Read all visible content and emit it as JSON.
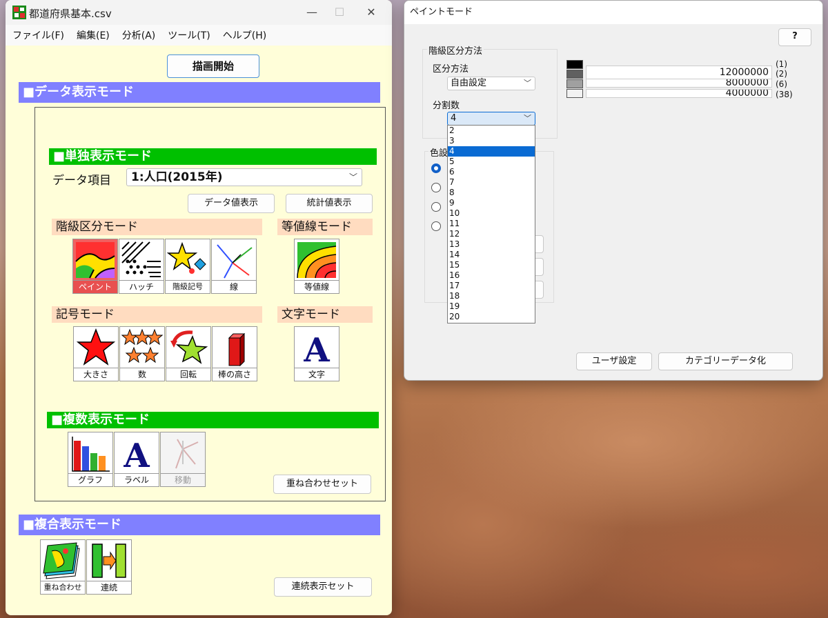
{
  "main": {
    "title": "都道府県基本.csv",
    "menu": [
      "ファイル(F)",
      "編集(E)",
      "分析(A)",
      "ツール(T)",
      "ヘルプ(H)"
    ],
    "draw_button": "描画開始",
    "data_mode_title": "■データ表示モード",
    "single_mode_title": "■単独表示モード",
    "data_item_label": "データ項目",
    "data_item_value": "1:人口(2015年)",
    "show_data_button": "データ値表示",
    "show_stats_button": "統計値表示",
    "class_mode_title": "階級区分モード",
    "contour_mode_title": "等値線モード",
    "class_tools": [
      "ペイント",
      "ハッチ",
      "階級記号",
      "線"
    ],
    "contour_tool": "等値線",
    "symbol_mode_title": "記号モード",
    "text_mode_title": "文字モード",
    "symbol_tools": [
      "大きさ",
      "数",
      "回転",
      "棒の高さ"
    ],
    "text_tool": "文字",
    "multi_mode_title": "■複数表示モード",
    "multi_tools": [
      "グラフ",
      "ラベル",
      "移動"
    ],
    "overlay_set_button": "重ね合わせセット",
    "composite_mode_title": "■複合表示モード",
    "composite_tools": [
      "重ね合わせ",
      "連続"
    ],
    "continuous_set_button": "連続表示セット"
  },
  "paint": {
    "title": "ペイントモード",
    "help_button": "?",
    "class_method_group": "階級区分方法",
    "division_method_label": "区分方法",
    "division_method_value": "自由設定",
    "division_count_label": "分割数",
    "division_count_value": "4",
    "division_options": [
      "2",
      "3",
      "4",
      "5",
      "6",
      "7",
      "8",
      "9",
      "10",
      "11",
      "12",
      "13",
      "14",
      "15",
      "16",
      "17",
      "18",
      "19",
      "20"
    ],
    "selected_option_index": 2,
    "color_group_label": "色設",
    "classes": [
      {
        "color": "#000000",
        "value": "",
        "count": "(1)"
      },
      {
        "color": "#606060",
        "value": "12000000",
        "count": "(2)"
      },
      {
        "color": "#a0a0a0",
        "value": "8000000",
        "count": "(6)"
      },
      {
        "color": "#f2f2f2",
        "value": "4000000",
        "count": "(38)"
      }
    ],
    "user_setting_button": "ユーザ設定",
    "category_button": "カテゴリーデータ化"
  }
}
